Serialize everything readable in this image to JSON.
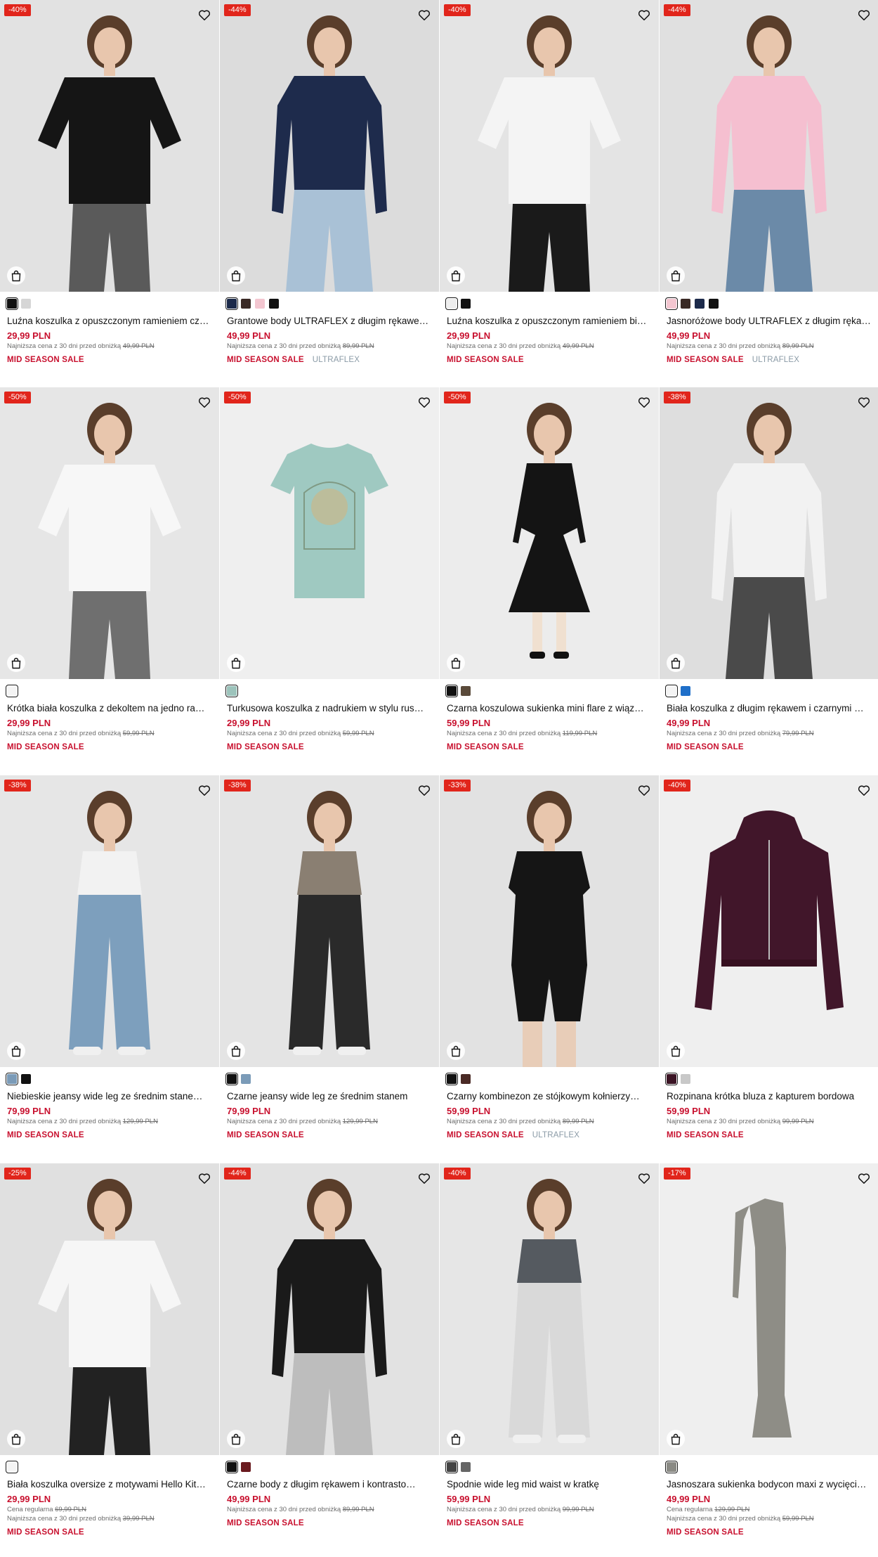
{
  "products": [
    {
      "discount": "-40%",
      "name": "Luźna koszulka z opuszczonym ramieniem cz…",
      "price": "29,99 PLN",
      "lowest_label": "Najniższa cena z 30 dni przed obniżką",
      "lowest_price": "49,99 PLN",
      "sale_tag": "MID SEASON SALE",
      "colors": [
        "#111111",
        "#d6d6d6"
      ],
      "bg": "#e2e2e2",
      "garment": "#151515",
      "style": "shirt",
      "legs": "#5a5a5a"
    },
    {
      "discount": "-44%",
      "name": "Grantowe body ULTRAFLEX z długim rękawe…",
      "price": "49,99 PLN",
      "lowest_label": "Najniższa cena z 30 dni przed obniżką",
      "lowest_price": "89,99 PLN",
      "sale_tag": "MID SEASON SALE",
      "brand_tag": "ULTRAFLEX",
      "colors": [
        "#1c2a4a",
        "#3a2a25",
        "#f3c6d0",
        "#111111"
      ],
      "bg": "#dcdcdc",
      "garment": "#1e2b4c",
      "style": "longsleeve",
      "legs": "#a9c1d6"
    },
    {
      "discount": "-40%",
      "name": "Luźna koszulka z opuszczonym ramieniem bi…",
      "price": "29,99 PLN",
      "lowest_label": "Najniższa cena z 30 dni przed obniżką",
      "lowest_price": "49,99 PLN",
      "sale_tag": "MID SEASON SALE",
      "colors": [
        "#eeeeee",
        "#111111"
      ],
      "bg": "#e4e4e4",
      "garment": "#f4f4f4",
      "style": "shirt",
      "legs": "#1a1a1a"
    },
    {
      "discount": "-44%",
      "name": "Jasnoróżowe body ULTRAFLEX z długim ręka…",
      "price": "49,99 PLN",
      "lowest_label": "Najniższa cena z 30 dni przed obniżką",
      "lowest_price": "89,99 PLN",
      "sale_tag": "MID SEASON SALE",
      "brand_tag": "ULTRAFLEX",
      "colors": [
        "#f3c6d0",
        "#3a2a25",
        "#1c2a4a",
        "#111111"
      ],
      "bg": "#e0e0e0",
      "garment": "#f5bfd0",
      "style": "longsleeve",
      "legs": "#6b8aa8"
    },
    {
      "discount": "-50%",
      "name": "Krótka biała koszulka z dekoltem na jedno ra…",
      "price": "29,99 PLN",
      "lowest_label": "Najniższa cena z 30 dni przed obniżką",
      "lowest_price": "59,99 PLN",
      "sale_tag": "MID SEASON SALE",
      "colors": [
        "#f4f4f4"
      ],
      "bg": "#e6e6e6",
      "garment": "#f7f7f7",
      "style": "shirt",
      "legs": "#6f6f6f"
    },
    {
      "discount": "-50%",
      "name": "Turkusowa koszulka z nadrukiem w stylu rus…",
      "price": "29,99 PLN",
      "lowest_label": "Najniższa cena z 30 dni przed obniżką",
      "lowest_price": "59,99 PLN",
      "sale_tag": "MID SEASON SALE",
      "colors": [
        "#9cc3bb"
      ],
      "bg": "#efefef",
      "garment": "#9fc9c1",
      "style": "flat-tee",
      "legs": ""
    },
    {
      "discount": "-50%",
      "name": "Czarna koszulowa sukienka mini flare z wiąz…",
      "price": "59,99 PLN",
      "lowest_label": "Najniższa cena z 30 dni przed obniżką",
      "lowest_price": "119,99 PLN",
      "sale_tag": "MID SEASON SALE",
      "colors": [
        "#111111",
        "#5a4a3a"
      ],
      "bg": "#ececec",
      "garment": "#141414",
      "style": "dress",
      "legs": "#f0e0d0"
    },
    {
      "discount": "-38%",
      "name": "Biała koszulka z długim rękawem i czarnymi …",
      "price": "49,99 PLN",
      "lowest_label": "Najniższa cena z 30 dni przed obniżką",
      "lowest_price": "79,99 PLN",
      "sale_tag": "MID SEASON SALE",
      "colors": [
        "#f4f4f4",
        "#1f6fc9"
      ],
      "bg": "#dedede",
      "garment": "#f2f2f2",
      "style": "longsleeve",
      "legs": "#4a4a4a"
    },
    {
      "discount": "-38%",
      "name": "Niebieskie jeansy wide leg ze średnim stane…",
      "price": "79,99 PLN",
      "lowest_label": "Najniższa cena z 30 dni przed obniżką",
      "lowest_price": "129,99 PLN",
      "sale_tag": "MID SEASON SALE",
      "colors": [
        "#7b9bb8",
        "#111111"
      ],
      "bg": "#e6e6e6",
      "garment": "#f2f2f2",
      "style": "jeans",
      "legs": "#7d9fbd"
    },
    {
      "discount": "-38%",
      "name": "Czarne jeansy wide leg ze średnim stanem",
      "price": "79,99 PLN",
      "lowest_label": "Najniższa cena z 30 dni przed obniżką",
      "lowest_price": "129,99 PLN",
      "sale_tag": "MID SEASON SALE",
      "colors": [
        "#111111",
        "#7b9bb8"
      ],
      "bg": "#e4e4e4",
      "garment": "#8a7f72",
      "style": "jeans",
      "legs": "#2a2a2a"
    },
    {
      "discount": "-33%",
      "name": "Czarny kombinezon ze stójkowym kołnierzy…",
      "price": "59,99 PLN",
      "lowest_label": "Najniższa cena z 30 dni przed obniżką",
      "lowest_price": "89,99 PLN",
      "sale_tag": "MID SEASON SALE",
      "brand_tag": "ULTRAFLEX",
      "colors": [
        "#111111",
        "#4a2a25"
      ],
      "bg": "#e2e2e2",
      "garment": "#151515",
      "style": "jumpsuit",
      "legs": "#e8cdb8"
    },
    {
      "discount": "-40%",
      "name": "Rozpinana krótka bluza z kapturem bordowa",
      "price": "59,99 PLN",
      "lowest_label": "Najniższa cena z 30 dni przed obniżką",
      "lowest_price": "99,99 PLN",
      "sale_tag": "MID SEASON SALE",
      "colors": [
        "#3b1424",
        "#c8c8c8"
      ],
      "bg": "#efefef",
      "garment": "#41162a",
      "style": "hoodie",
      "legs": ""
    },
    {
      "discount": "-25%",
      "name": "Biała koszulka oversize z motywami Hello Kit…",
      "price": "29,99 PLN",
      "regular_label": "Cena regularna",
      "regular_price": "69,99 PLN",
      "lowest_label": "Najniższa cena z 30 dni przed obniżką",
      "lowest_price": "39,99 PLN",
      "sale_tag": "MID SEASON SALE",
      "colors": [
        "#f4f4f4"
      ],
      "bg": "#e0e0e0",
      "garment": "#f6f6f6",
      "style": "shirt",
      "legs": "#222222"
    },
    {
      "discount": "-44%",
      "name": "Czarne body z długim rękawem i kontrasto…",
      "price": "49,99 PLN",
      "lowest_label": "Najniższa cena z 30 dni przed obniżką",
      "lowest_price": "89,99 PLN",
      "sale_tag": "MID SEASON SALE",
      "colors": [
        "#111111",
        "#6a1a1f"
      ],
      "bg": "#e2e2e2",
      "garment": "#1a1a1a",
      "style": "longsleeve",
      "legs": "#bdbdbd"
    },
    {
      "discount": "-40%",
      "name": "Spodnie wide leg mid waist w kratkę",
      "price": "59,99 PLN",
      "lowest_label": "Najniższa cena z 30 dni przed obniżką",
      "lowest_price": "99,99 PLN",
      "sale_tag": "MID SEASON SALE",
      "colors": [
        "#444444",
        "#666666"
      ],
      "bg": "#e6e6e6",
      "garment": "#555a60",
      "style": "jeans",
      "legs": "#d9d9d9"
    },
    {
      "discount": "-17%",
      "name": "Jasnoszara sukienka bodycon maxi z wycięci…",
      "price": "49,99 PLN",
      "regular_label": "Cena regularna",
      "regular_price": "129,99 PLN",
      "lowest_label": "Najniższa cena z 30 dni przed obniżką",
      "lowest_price": "59,99 PLN",
      "sale_tag": "MID SEASON SALE",
      "colors": [
        "#8a8a84"
      ],
      "bg": "#efefef",
      "garment": "#8e8d86",
      "style": "flat-dress",
      "legs": ""
    }
  ]
}
